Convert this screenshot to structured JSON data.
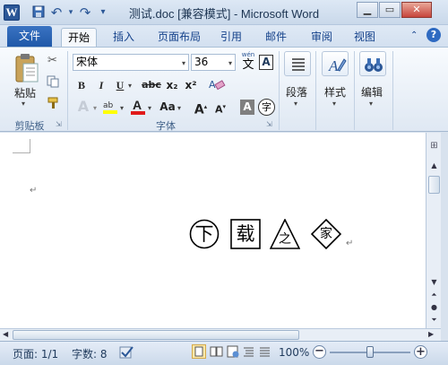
{
  "window": {
    "title": "测试.doc [兼容模式] - Microsoft Word",
    "app_icon": "W",
    "help": "?"
  },
  "quick_access": {
    "save_icon": "save-icon",
    "undo": "↶",
    "redo": "↷",
    "customize": "▾"
  },
  "tabs": [
    "文件",
    "开始",
    "插入",
    "页面布局",
    "引用",
    "邮件",
    "审阅",
    "视图"
  ],
  "clipboard": {
    "paste": "粘贴",
    "group": "剪贴板"
  },
  "font": {
    "family": "宋体",
    "size": "36",
    "group": "字体",
    "bold": "B",
    "italic": "I",
    "underline": "U",
    "strike": "abc",
    "sub": "x₂",
    "sup": "x²",
    "case": "Aa",
    "grow": "A",
    "shrink": "A",
    "phonetic": "wén",
    "phonetic_char": "文",
    "border_char": "A",
    "charshade": "A",
    "enclose": "字"
  },
  "paragraph": {
    "label": "段落"
  },
  "styles": {
    "label": "样式"
  },
  "editing": {
    "label": "编辑"
  },
  "document": {
    "enclosed_chars": [
      "下",
      "载",
      "之",
      "家"
    ],
    "shapes": [
      "circle",
      "square",
      "triangle",
      "diamond"
    ]
  },
  "status": {
    "page": "页面: 1/1",
    "words": "字数: 8",
    "zoom": "100%",
    "zoom_level": 0.5
  }
}
